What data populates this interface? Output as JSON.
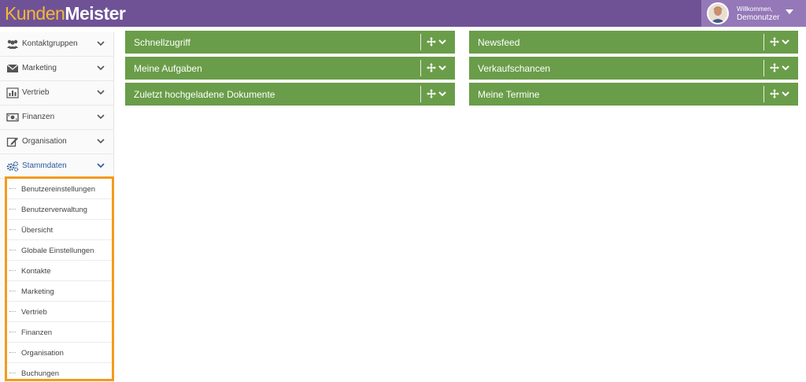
{
  "header": {
    "logo_part1": "Kunden",
    "logo_part2": "Meister",
    "welcome": "Willkommen,",
    "username": "Demonutzer",
    "avatar_icon": "user-avatar",
    "menu_icon": "caret-down-icon"
  },
  "sidebar": {
    "items": [
      {
        "label": "Kontaktgruppen",
        "icon": "users-icon"
      },
      {
        "label": "Marketing",
        "icon": "envelope-icon"
      },
      {
        "label": "Vertrieb",
        "icon": "bar-chart-icon"
      },
      {
        "label": "Finanzen",
        "icon": "money-icon"
      },
      {
        "label": "Organisation",
        "icon": "edit-icon"
      },
      {
        "label": "Stammdaten",
        "icon": "cogs-icon",
        "active": true
      }
    ],
    "submenu": [
      "Benutzereinstellungen",
      "Benutzerverwaltung",
      "Übersicht",
      "Globale Einstellungen",
      "Kontakte",
      "Marketing",
      "Vertrieb",
      "Finanzen",
      "Organisation",
      "Buchungen"
    ]
  },
  "widgets": {
    "left": [
      "Schnellzugriff",
      "Meine Aufgaben",
      "Zuletzt hochgeladene Dokumente"
    ],
    "right": [
      "Newsfeed",
      "Verkaufschancen",
      "Meine Termine"
    ]
  },
  "colors": {
    "header_bg": "#6f5296",
    "user_box_bg": "#9478b8",
    "widget_bg": "#6a9d49",
    "highlight_border": "#f39b1c",
    "logo_accent": "#f3b73b",
    "active_link": "#2b5a9e"
  }
}
